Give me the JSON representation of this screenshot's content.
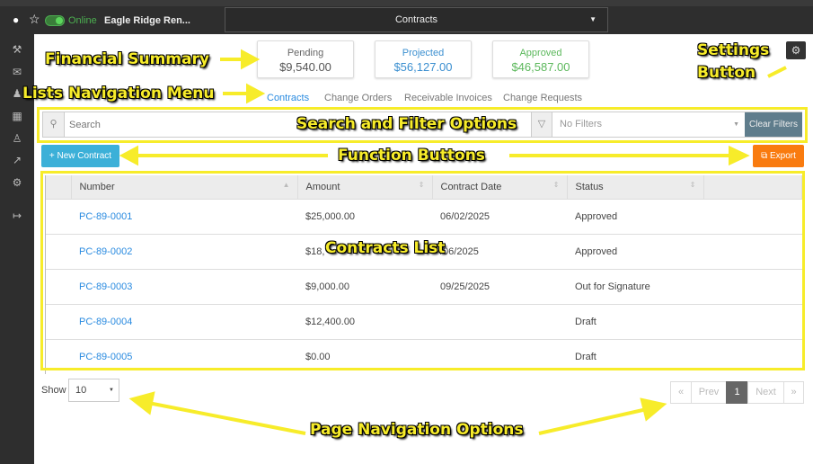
{
  "topbar": {
    "status": "Online",
    "project": "Eagle Ridge Ren...",
    "module": "Contracts"
  },
  "summary": [
    {
      "label": "Pending",
      "value": "$9,540.00",
      "color": "#555555"
    },
    {
      "label": "Projected",
      "value": "$56,127.00",
      "color": "#3b8fd0"
    },
    {
      "label": "Approved",
      "value": "$46,587.00",
      "color": "#5cb85c"
    }
  ],
  "tabs": [
    "Contracts",
    "Change Orders",
    "Receivable Invoices",
    "Change Requests"
  ],
  "search": {
    "placeholder": "Search",
    "filter_placeholder": "No Filters",
    "clear": "Clear Filters"
  },
  "buttons": {
    "new_contract": "+ New Contract",
    "export": "Export"
  },
  "table": {
    "columns": [
      "Number",
      "Amount",
      "Contract Date",
      "Status"
    ],
    "rows": [
      [
        "PC-89-0001",
        "$25,000.00",
        "06/02/2025",
        "Approved"
      ],
      [
        "PC-89-0002",
        "$18,",
        "/06/2025",
        "Approved"
      ],
      [
        "PC-89-0003",
        "$9,000.00",
        "09/25/2025",
        "Out for Signature"
      ],
      [
        "PC-89-0004",
        "$12,400.00",
        "",
        "Draft"
      ],
      [
        "PC-89-0005",
        "$0.00",
        "",
        "Draft"
      ]
    ]
  },
  "pagination": {
    "show_label": "Show",
    "page_size": "10",
    "first": "«",
    "prev": "Prev",
    "current": "1",
    "next": "Next",
    "last": "»"
  },
  "annotations": {
    "financial": "Financial Summary",
    "lists": "Lists Navigation Menu",
    "search": "Search and Filter Options",
    "functions": "Function Buttons",
    "settings1": "Settings",
    "settings2": "Button",
    "contracts": "Contracts List",
    "page": "Page Navigation Options"
  },
  "colors": {
    "accent": "#2a8be0",
    "new_button": "#3cb0d8",
    "export_button": "#f97b0f",
    "clear_filters": "#5f7d8c",
    "annotation": "#f7ec2a"
  }
}
